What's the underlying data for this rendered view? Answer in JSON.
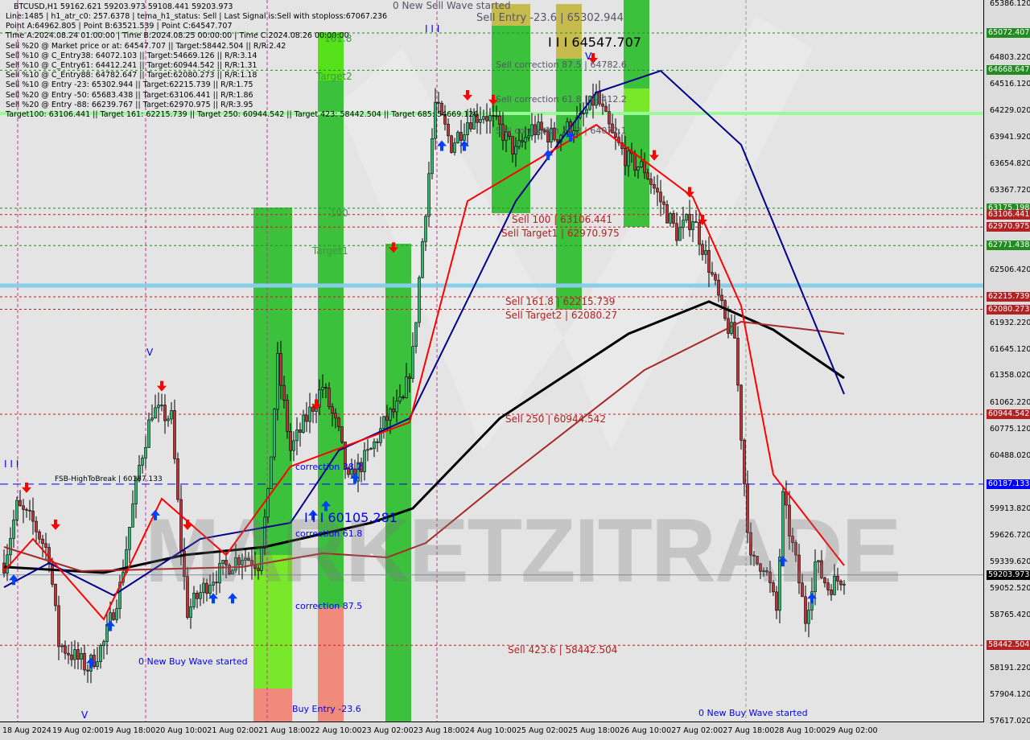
{
  "header": {
    "symbol_line": "BTCUSD,H1  59162.621 59203.973 59108.441 59203.973",
    "info_lines": [
      "Line:1485 | h1_atr_c0: 257.6378 | tema_h1_status: Sell | Last Signal is:Sell with stoploss:67067.236",
      "Point A:64962.805 | Point B:63521.539 | Point C:64547.707",
      "Time A:2024.08.24 01:00:00 | Time B:2024.08.25 00:00:00 | Time C:2024.08.26 00:00:00",
      "Sell %20 @ Market price or at: 64547.707 || Target:58442.504 || R/R:2.42",
      "Sell %10 @ C_Entry38: 64072.103 || Target:54669.126 || R/R:3.14",
      "Sell %10 @ C_Entry61: 64412.241 || Target:60944.542 || R/R:1.31",
      "Sell %10 @ C_Entry88: 64782.647 || Target:62080.273 || R/R:1.18",
      "Sell %10 @ Entry -23: 65302.944 || Target:62215.739 || R/R:1.75",
      "Sell %20 @ Entry -50: 65683.438 || Target:63106.441 || R/R:1.86",
      "Sell %20 @ Entry -88: 66239.767 || Target:62970.975 || R/R:3.95",
      "Target100: 63106.441 || Target 161: 62215.739 || Target 250: 60944.542 || Target 423: 58442.504 || Target 685: 54669.126"
    ]
  },
  "annotations": {
    "new_sell_wave": "0 New Sell Wave started",
    "fib_161": "161.8",
    "target2": "Target2",
    "fib_100": "100",
    "target1": "Target1",
    "sell_entry": "Sell Entry -23.6 | 65302.944",
    "point_c": "I I I 64547.707",
    "sell_corr_875": "Sell correction 87.5 | 64782.6",
    "sell_corr_618": "Sell correction 61.8 | 64412.2",
    "sell_corr_382": "Sell correction 38.2 | 64072.1",
    "sell_100": "Sell 100 | 63106.441",
    "sell_target1": "Sell Target1 | 62970.975",
    "sell_161": "Sell 161.8 | 62215.739",
    "sell_target2": "Sell Target2 | 62080.27",
    "sell_250": "Sell 250 | 60944.542",
    "sell_423": "Sell 423.6 | 58442.504",
    "corr_382": "correction 38.2",
    "buy_point": "I I I 60105.281",
    "corr_618": "correction 61.8",
    "corr_875": "correction 87.5",
    "buy_entry": "Buy Entry -23.6",
    "new_buy_wave_1": "0 New Buy Wave started",
    "new_buy_wave_2": "0 New Buy Wave started",
    "fsb": "FSB-HighToBreak | 60187.133",
    "marker_iii_1": "I I I",
    "marker_iii_2": "I I I",
    "marker_v_1": "V",
    "marker_v_2": "V",
    "marker_v_3": "V",
    "watermark": "MARKETZITRADE"
  },
  "price_axis": {
    "ticks": [
      "65386.120",
      "64803.220",
      "64516.120",
      "64229.020",
      "63941.920",
      "63654.820",
      "63367.720",
      "62506.420",
      "61932.220",
      "61645.120",
      "61358.020",
      "61062.220",
      "60775.120",
      "60488.020",
      "59913.820",
      "59626.720",
      "59339.620",
      "59052.520",
      "58765.420",
      "58191.220",
      "57904.120",
      "57617.020"
    ],
    "levels": [
      {
        "price": "65072.407",
        "color": "#228b22",
        "style": "dash"
      },
      {
        "price": "64668.647",
        "color": "#228b22",
        "style": "dash"
      },
      {
        "price": "63175.198",
        "color": "#228b22",
        "style": "dash"
      },
      {
        "price": "63106.441",
        "color": "#b22222",
        "style": "dash"
      },
      {
        "price": "62970.975",
        "color": "#b22222",
        "style": "dash"
      },
      {
        "price": "62771.438",
        "color": "#228b22",
        "style": "dash"
      },
      {
        "price": "62215.739",
        "color": "#b22222",
        "style": "dash"
      },
      {
        "price": "62080.273",
        "color": "#b22222",
        "style": "dash"
      },
      {
        "price": "60944.542",
        "color": "#b22222",
        "style": "dash"
      },
      {
        "price": "60187.133",
        "color": "#0000ff",
        "style": "longdash"
      },
      {
        "price": "59203.973",
        "color": "#000000",
        "style": "solid"
      },
      {
        "price": "58442.504",
        "color": "#b22222",
        "style": "dash"
      }
    ]
  },
  "time_axis": {
    "ticks": [
      "18 Aug 2024",
      "19 Aug 02:00",
      "19 Aug 18:00",
      "20 Aug 10:00",
      "21 Aug 02:00",
      "21 Aug 18:00",
      "22 Aug 10:00",
      "23 Aug 02:00",
      "23 Aug 18:00",
      "24 Aug 10:00",
      "25 Aug 02:00",
      "25 Aug 18:00",
      "26 Aug 10:00",
      "27 Aug 02:00",
      "27 Aug 18:00",
      "28 Aug 10:00",
      "29 Aug 02:00"
    ]
  },
  "chart_data": {
    "type": "candlestick",
    "symbol": "BTCUSD",
    "timeframe": "H1",
    "ylim": [
      57617.02,
      65386.12
    ],
    "grid": false,
    "close_path": [
      [
        "2024-08-18 11:00",
        59333
      ],
      [
        "2024-08-18 15:00",
        59942
      ],
      [
        "2024-08-18 20:00",
        59768
      ],
      [
        "2024-08-19 01:00",
        59420
      ],
      [
        "2024-08-19 04:00",
        58462
      ],
      [
        "2024-08-19 13:00",
        58200
      ],
      [
        "2024-08-19 18:00",
        58462
      ],
      [
        "2024-08-19 23:00",
        59071
      ],
      [
        "2024-08-20 05:00",
        60378
      ],
      [
        "2024-08-20 09:00",
        60988
      ],
      [
        "2024-08-20 15:00",
        60900
      ],
      [
        "2024-08-20 18:00",
        59507
      ],
      [
        "2024-08-20 20:00",
        58810
      ],
      [
        "2024-08-21 03:00",
        59158
      ],
      [
        "2024-08-21 13:00",
        59420
      ],
      [
        "2024-08-21 18:00",
        59333
      ],
      [
        "2024-08-21 21:00",
        60030
      ],
      [
        "2024-08-22 00:00",
        61510
      ],
      [
        "2024-08-22 04:00",
        60552
      ],
      [
        "2024-08-22 09:00",
        60900
      ],
      [
        "2024-08-22 14:00",
        61249
      ],
      [
        "2024-08-22 19:00",
        60726
      ],
      [
        "2024-08-22 22:00",
        60204
      ],
      [
        "2024-08-23 05:00",
        60552
      ],
      [
        "2024-08-23 10:00",
        60900
      ],
      [
        "2024-08-23 15:00",
        61075
      ],
      [
        "2024-08-23 18:00",
        61597
      ],
      [
        "2024-08-23 21:00",
        62817
      ],
      [
        "2024-08-24 01:00",
        64297
      ],
      [
        "2024-08-24 06:00",
        63862
      ],
      [
        "2024-08-24 11:00",
        64123
      ],
      [
        "2024-08-24 16:00",
        64210
      ],
      [
        "2024-08-24 21:00",
        64036
      ],
      [
        "2024-08-25 02:00",
        63775
      ],
      [
        "2024-08-25 07:00",
        64036
      ],
      [
        "2024-08-25 14:00",
        63949
      ],
      [
        "2024-08-25 22:00",
        64123
      ],
      [
        "2024-08-26 03:00",
        64384
      ],
      [
        "2024-08-26 08:00",
        63949
      ],
      [
        "2024-08-26 13:00",
        63688
      ],
      [
        "2024-08-26 18:00",
        63601
      ],
      [
        "2024-08-26 23:00",
        63252
      ],
      [
        "2024-08-27 04:00",
        62904
      ],
      [
        "2024-08-27 09:00",
        63078
      ],
      [
        "2024-08-27 14:00",
        62555
      ],
      [
        "2024-08-27 19:00",
        61946
      ],
      [
        "2024-08-27 22:00",
        61772
      ],
      [
        "2024-08-28 01:00",
        60204
      ],
      [
        "2024-08-28 03:00",
        59333
      ],
      [
        "2024-08-28 07:00",
        59333
      ],
      [
        "2024-08-28 11:00",
        58810
      ],
      [
        "2024-08-28 13:00",
        60030
      ],
      [
        "2024-08-28 17:00",
        59333
      ],
      [
        "2024-08-28 20:00",
        58723
      ],
      [
        "2024-08-28 23:00",
        59333
      ],
      [
        "2024-08-29 03:00",
        59071
      ],
      [
        "2024-08-29 08:00",
        59204
      ]
    ],
    "indicators": [
      {
        "color": "#000000",
        "points": [
          [
            "2024-08-18 11:00",
            59290
          ],
          [
            "2024-08-19 18:00",
            59228
          ],
          [
            "2024-08-20 19:00",
            59420
          ],
          [
            "2024-08-21 20:00",
            59507
          ],
          [
            "2024-08-23 05:00",
            59768
          ],
          [
            "2024-08-23 18:00",
            59925
          ],
          [
            "2024-08-24 21:00",
            60900
          ],
          [
            "2024-08-26 13:00",
            61815
          ],
          [
            "2024-08-27 14:00",
            62164
          ],
          [
            "2024-08-28 10:00",
            61859
          ],
          [
            "2024-08-29 08:00",
            61336
          ]
        ]
      },
      {
        "color": "#a52a2a",
        "points": [
          [
            "2024-08-18 11:00",
            59507
          ],
          [
            "2024-08-19 11:00",
            59246
          ],
          [
            "2024-08-21 13:00",
            59290
          ],
          [
            "2024-08-22 14:00",
            59438
          ],
          [
            "2024-08-23 10:00",
            59394
          ],
          [
            "2024-08-23 22:00",
            59550
          ],
          [
            "2024-08-24 21:00",
            60204
          ],
          [
            "2024-08-26 18:00",
            61423
          ],
          [
            "2024-08-28 00:00",
            61946
          ],
          [
            "2024-08-29 08:00",
            61815
          ]
        ]
      },
      {
        "color": "#00008b",
        "points": [
          [
            "2024-08-18 11:00",
            59071
          ],
          [
            "2024-08-19 01:00",
            59333
          ],
          [
            "2024-08-19 21:00",
            58984
          ],
          [
            "2024-08-21 00:00",
            59594
          ],
          [
            "2024-08-22 04:00",
            59768
          ],
          [
            "2024-08-22 19:00",
            60552
          ],
          [
            "2024-08-23 17:00",
            60900
          ],
          [
            "2024-08-25 02:00",
            63252
          ],
          [
            "2024-08-26 03:00",
            64428
          ],
          [
            "2024-08-26 23:00",
            64663
          ],
          [
            "2024-08-28 00:00",
            63862
          ],
          [
            "2024-08-29 08:00",
            61162
          ]
        ]
      },
      {
        "color": "#ff0000",
        "points": [
          [
            "2024-08-18 11:00",
            59246
          ],
          [
            "2024-08-18 20:00",
            59594
          ],
          [
            "2024-08-19 18:00",
            58723
          ],
          [
            "2024-08-20 12:00",
            60030
          ],
          [
            "2024-08-21 08:00",
            59420
          ],
          [
            "2024-08-22 04:00",
            60378
          ],
          [
            "2024-08-23 17:00",
            60857
          ],
          [
            "2024-08-24 11:00",
            63252
          ],
          [
            "2024-08-26 03:00",
            64079
          ],
          [
            "2024-08-27 09:00",
            63296
          ],
          [
            "2024-08-28 00:00",
            62120
          ],
          [
            "2024-08-28 10:00",
            60291
          ],
          [
            "2024-08-29 08:00",
            59307
          ]
        ]
      }
    ],
    "sell_arrows": [
      [
        "2024-08-18 18:00",
        60100
      ],
      [
        "2024-08-19 03:00",
        59700
      ],
      [
        "2024-08-20 12:00",
        61200
      ],
      [
        "2024-08-20 20:00",
        59700
      ],
      [
        "2024-08-22 12:00",
        61000
      ],
      [
        "2024-08-23 12:00",
        62700
      ],
      [
        "2024-08-24 11:00",
        64350
      ],
      [
        "2024-08-24 19:00",
        64300
      ],
      [
        "2024-08-26 02:00",
        64750
      ],
      [
        "2024-08-26 21:00",
        63700
      ],
      [
        "2024-08-27 08:00",
        63300
      ],
      [
        "2024-08-27 12:00",
        63000
      ]
    ],
    "buy_arrows": [
      [
        "2024-08-18 14:00",
        59200
      ],
      [
        "2024-08-19 14:00",
        58300
      ],
      [
        "2024-08-19 20:00",
        58700
      ],
      [
        "2024-08-20 10:00",
        59900
      ],
      [
        "2024-08-21 04:00",
        59000
      ],
      [
        "2024-08-21 10:00",
        59000
      ],
      [
        "2024-08-22 11:00",
        59900
      ],
      [
        "2024-08-22 15:00",
        60000
      ],
      [
        "2024-08-23 00:00",
        60300
      ],
      [
        "2024-08-24 03:00",
        63900
      ],
      [
        "2024-08-24 10:00",
        63900
      ],
      [
        "2024-08-25 12:00",
        63800
      ],
      [
        "2024-08-25 19:00",
        64000
      ],
      [
        "2024-08-28 13:00",
        59400
      ],
      [
        "2024-08-28 22:00",
        59000
      ]
    ]
  }
}
